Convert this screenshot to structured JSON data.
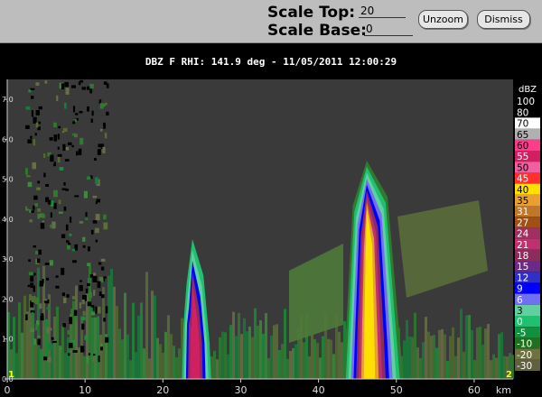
{
  "controls": {
    "scale_top_label": "Scale Top:",
    "scale_top_value": "20",
    "scale_base_label": "Scale Base:",
    "scale_base_value": "0",
    "unzoom_label": "Unzoom",
    "dismiss_label": "Dismiss"
  },
  "plot": {
    "title": "DBZ F  RHI: 141.9 deg  -  11/05/2011 12:00:29",
    "x_ticks": [
      "0",
      "10",
      "20",
      "30",
      "40",
      "50",
      "60"
    ],
    "x_unit": "km",
    "y_ticks": [
      "0.0",
      "1.0",
      "2.0",
      "3.0",
      "4.0",
      "5.0",
      "6.0",
      "7.0"
    ],
    "corner_left": "1",
    "corner_right": "2"
  },
  "colorbar": {
    "unit": "dBZ",
    "entries": [
      {
        "label": "100",
        "color": "#000000"
      },
      {
        "label": "80",
        "color": "#000000"
      },
      {
        "label": "70",
        "color": "#ffffff"
      },
      {
        "label": "65",
        "color": "#b0b0b0"
      },
      {
        "label": "60",
        "color": "#ff3c8c"
      },
      {
        "label": "55",
        "color": "#d02060"
      },
      {
        "label": "50",
        "color": "#f060a0"
      },
      {
        "label": "45",
        "color": "#ff3030"
      },
      {
        "label": "40",
        "color": "#ffe000"
      },
      {
        "label": "35",
        "color": "#e8a030"
      },
      {
        "label": "31",
        "color": "#c07828"
      },
      {
        "label": "27",
        "color": "#a05010"
      },
      {
        "label": "24",
        "color": "#a03060"
      },
      {
        "label": "21",
        "color": "#c03070"
      },
      {
        "label": "18",
        "color": "#8a2c5c"
      },
      {
        "label": "15",
        "color": "#6a2a8a"
      },
      {
        "label": "12",
        "color": "#3030c8"
      },
      {
        "label": "9",
        "color": "#0000ff"
      },
      {
        "label": "6",
        "color": "#7070f0"
      },
      {
        "label": "3",
        "color": "#60d0a0"
      },
      {
        "label": "0",
        "color": "#20c070"
      },
      {
        "label": "-5",
        "color": "#109040"
      },
      {
        "label": "-10",
        "color": "#207020"
      },
      {
        "label": "-20",
        "color": "#707040"
      },
      {
        "label": "-30",
        "color": "#606040"
      }
    ]
  }
}
